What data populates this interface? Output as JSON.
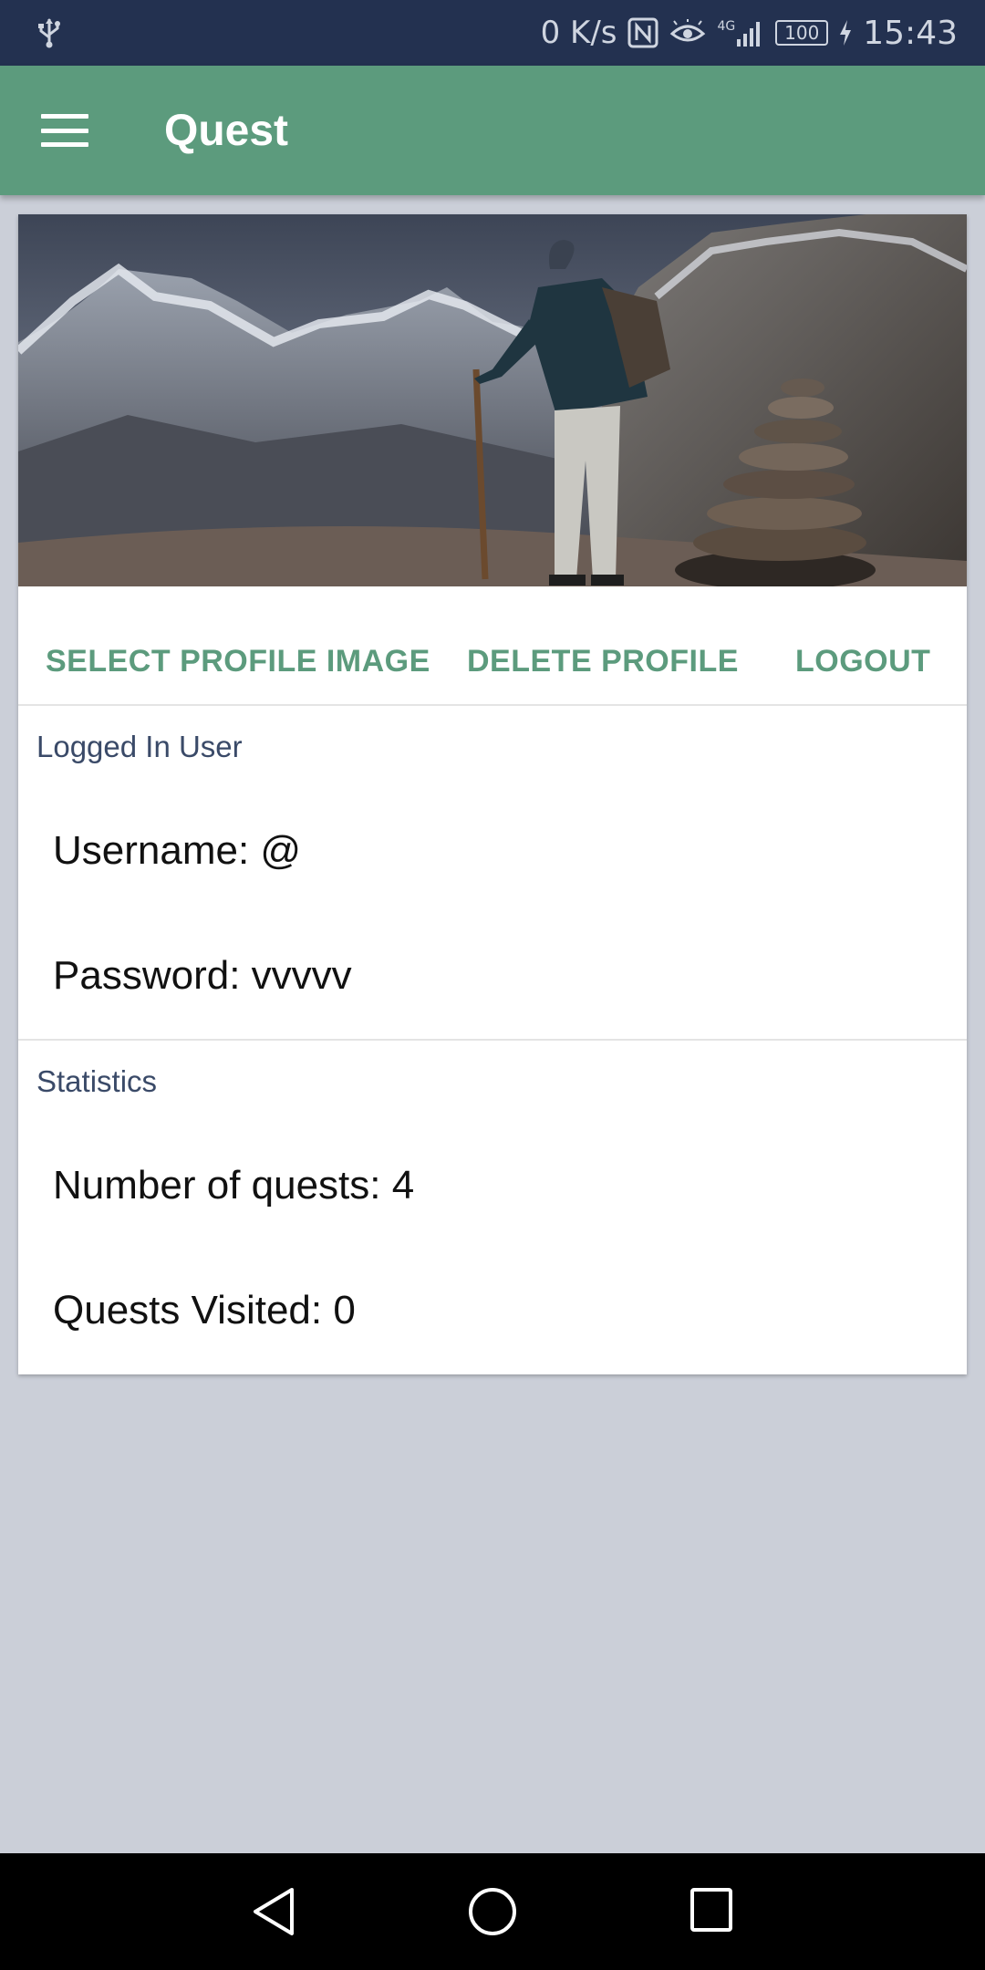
{
  "status_bar": {
    "network_speed": "0 K/s",
    "network_type": "4G",
    "battery": "100",
    "time": "15:43"
  },
  "app_bar": {
    "title": "Quest"
  },
  "profile_card": {
    "actions": {
      "select_image": "SELECT PROFILE IMAGE",
      "delete_profile": "DELETE PROFILE",
      "logout": "LOGOUT"
    },
    "logged_in_section": {
      "title": "Logged In User",
      "username": "Username: @",
      "password": "Password: vvvvv"
    },
    "statistics_section": {
      "title": "Statistics",
      "number_of_quests": "Number of quests: 4",
      "quests_visited": "Quests Visited: 0"
    }
  },
  "colors": {
    "accent": "#5c9b7d",
    "status_bar": "#233150",
    "background": "#cbcfd8"
  }
}
